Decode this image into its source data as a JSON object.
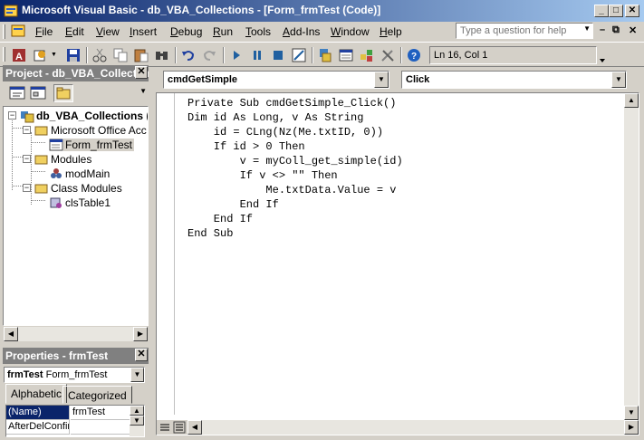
{
  "window": {
    "title": "Microsoft Visual Basic - db_VBA_Collections - [Form_frmTest (Code)]"
  },
  "menu": {
    "items": [
      {
        "label": "File",
        "key": "F"
      },
      {
        "label": "Edit",
        "key": "E"
      },
      {
        "label": "View",
        "key": "V"
      },
      {
        "label": "Insert",
        "key": "I"
      },
      {
        "label": "Debug",
        "key": "D"
      },
      {
        "label": "Run",
        "key": "R"
      },
      {
        "label": "Tools",
        "key": "T"
      },
      {
        "label": "Add-Ins",
        "key": "A"
      },
      {
        "label": "Window",
        "key": "W"
      },
      {
        "label": "Help",
        "key": "H"
      }
    ],
    "help_placeholder": "Type a question for help"
  },
  "toolbar": {
    "status": "Ln 16, Col 1",
    "icons": [
      "access-view-icon",
      "insert-module-icon",
      "save-icon",
      "cut-icon",
      "copy-icon",
      "paste-icon",
      "find-icon",
      "undo-icon",
      "redo-icon",
      "run-icon",
      "break-icon",
      "reset-icon",
      "design-mode-icon",
      "project-explorer-icon",
      "properties-window-icon",
      "object-browser-icon",
      "toolbox-icon",
      "help-icon"
    ]
  },
  "project": {
    "title": "Project - db_VBA_Collections",
    "tree": {
      "root": "db_VBA_Collections (",
      "folder_office": "Microsoft Office Acc",
      "form": "Form_frmTest",
      "folder_modules": "Modules",
      "module": "modMain",
      "folder_class": "Class Modules",
      "class": "clsTable1"
    }
  },
  "properties": {
    "title": "Properties - frmTest",
    "object_name": "frmTest",
    "object_type": "Form_frmTest",
    "tabs": [
      "Alphabetic",
      "Categorized"
    ],
    "rows": [
      {
        "name": "(Name)",
        "value": "frmTest"
      },
      {
        "name": "AfterDelConfir",
        "value": ""
      }
    ]
  },
  "code": {
    "object_combo": "cmdGetSimple",
    "proc_combo": "Click",
    "lines": [
      "Private Sub cmdGetSimple_Click()",
      "Dim id As Long, v As String",
      "    id = CLng(Nz(Me.txtID, 0))",
      "    If id > 0 Then",
      "        v = myColl_get_simple(id)",
      "        If v <> \"\" Then",
      "            Me.txtData.Value = v",
      "        End If",
      "    End If",
      "End Sub"
    ]
  },
  "colors": {
    "titlebar_start": "#0a246a",
    "titlebar_end": "#a6caf0",
    "face": "#d4d0c8"
  }
}
